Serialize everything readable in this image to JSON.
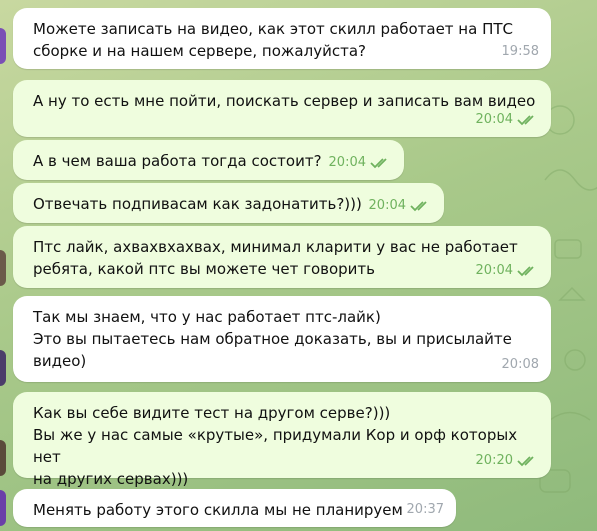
{
  "messages": [
    {
      "direction": "in",
      "text": "Можете записать на видео, как этот скилл работает на ПТС\nсборке и на нашем сервере, пожалуйста?",
      "time": "19:58"
    },
    {
      "direction": "out",
      "text": "А ну то есть мне пойти, поискать сервер и записать вам видео",
      "time": "20:04",
      "status": "read"
    },
    {
      "direction": "out",
      "text": "А в чем ваша работа тогда состоит?",
      "time": "20:04",
      "status": "read"
    },
    {
      "direction": "out",
      "text": "Отвечать подпивасам как задонатить?)))",
      "time": "20:04",
      "status": "read"
    },
    {
      "direction": "out",
      "text": "Птс лайк, ахвахвхахвах, минимал кларити у вас не работает\nребята, какой птс вы можете чет говорить",
      "time": "20:04",
      "status": "read"
    },
    {
      "direction": "in",
      "text": "Так мы знаем, что у нас работает птс-лайк)\nЭто вы пытаетесь нам обратное доказать, вы и присылайте\nвидео)",
      "time": "20:08"
    },
    {
      "direction": "out",
      "text": "Как вы себе видите тест на другом серве?)))\nВы же у нас самые «крутые», придумали Кор и орф которых нет\nна других сервах)))",
      "time": "20:20",
      "status": "read"
    },
    {
      "direction": "in",
      "text": "Менять работу этого скилла мы не планируем",
      "time": "20:37"
    }
  ],
  "colors": {
    "incoming_bubble": "#ffffff",
    "outgoing_bubble": "#effdde",
    "outgoing_meta": "#6fb25e",
    "incoming_meta": "#a0a7ae"
  },
  "icons": {
    "read_status": "double-check-icon"
  }
}
